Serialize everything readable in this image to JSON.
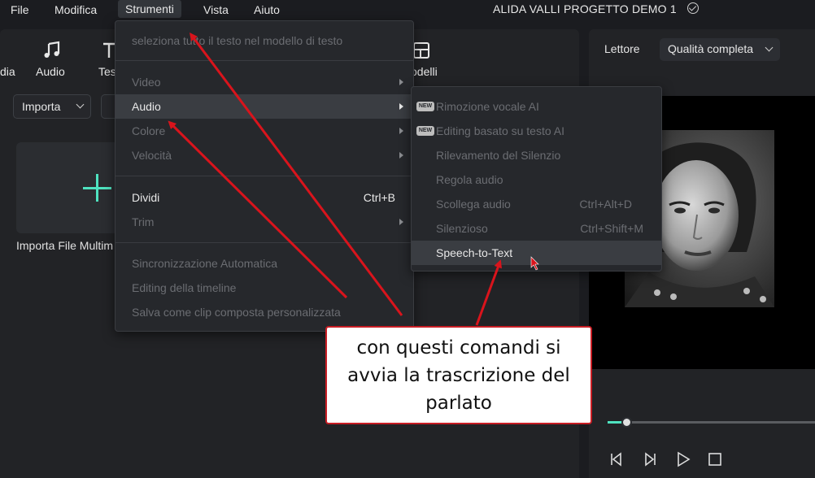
{
  "menubar": {
    "items": [
      "File",
      "Modifica",
      "Strumenti",
      "Vista",
      "Aiuto"
    ],
    "project_title": "ALIDA VALLI PROGETTO DEMO 1",
    "check_icon": "check-circle-icon"
  },
  "media_toolbar": {
    "items": [
      {
        "label": "dia",
        "icon": ""
      },
      {
        "label": "Audio",
        "icon": "music-note-icon"
      },
      {
        "label": "Tes",
        "icon": "text-icon"
      },
      {
        "label": "odelli",
        "icon": "template-icon"
      }
    ],
    "import_button": "Importa",
    "import_tile_label": "Importa File Multim"
  },
  "player": {
    "label": "Lettore",
    "quality": "Qualità completa",
    "progress_fraction": 0.08,
    "controls": [
      "prev-frame-icon",
      "next-frame-icon",
      "play-icon",
      "stop-icon"
    ]
  },
  "strumenti_menu": {
    "items": [
      {
        "label": "seleziona tutto il testo nel modello di testo",
        "enabled": false,
        "shortcut": "",
        "submenu": false
      },
      {
        "label": "Video",
        "enabled": false,
        "shortcut": "",
        "submenu": true
      },
      {
        "label": "Audio",
        "enabled": true,
        "shortcut": "",
        "submenu": true,
        "highlighted": true
      },
      {
        "label": "Colore",
        "enabled": false,
        "shortcut": "",
        "submenu": true
      },
      {
        "label": "Velocità",
        "enabled": false,
        "shortcut": "",
        "submenu": true
      },
      {
        "label": "Dividi",
        "enabled": true,
        "shortcut": "Ctrl+B",
        "submenu": false
      },
      {
        "label": "Trim",
        "enabled": false,
        "shortcut": "",
        "submenu": true
      },
      {
        "label": "Sincronizzazione Automatica",
        "enabled": false,
        "shortcut": "",
        "submenu": false
      },
      {
        "label": "Editing della timeline",
        "enabled": false,
        "shortcut": "",
        "submenu": false
      },
      {
        "label": "Salva come clip composta personalizzata",
        "enabled": false,
        "shortcut": "",
        "submenu": false
      }
    ]
  },
  "audio_submenu": {
    "items": [
      {
        "label": "Rimozione vocale AI",
        "badge": "NEW",
        "shortcut": "",
        "enabled": false
      },
      {
        "label": "Editing basato su testo AI",
        "badge": "NEW",
        "shortcut": "",
        "enabled": false
      },
      {
        "label": "Rilevamento del Silenzio",
        "badge": "",
        "shortcut": "",
        "enabled": false
      },
      {
        "label": "Regola audio",
        "badge": "",
        "shortcut": "",
        "enabled": false
      },
      {
        "label": "Scollega audio",
        "badge": "",
        "shortcut": "Ctrl+Alt+D",
        "enabled": false
      },
      {
        "label": "Silenzioso",
        "badge": "",
        "shortcut": "Ctrl+Shift+M",
        "enabled": false
      },
      {
        "label": "Speech-to-Text",
        "badge": "",
        "shortcut": "",
        "enabled": true,
        "highlighted": true
      }
    ]
  },
  "annotation": {
    "lines": [
      "con questi comandi si",
      "avvia la trascrizione del",
      "parlato"
    ],
    "color": "#d9141c"
  }
}
